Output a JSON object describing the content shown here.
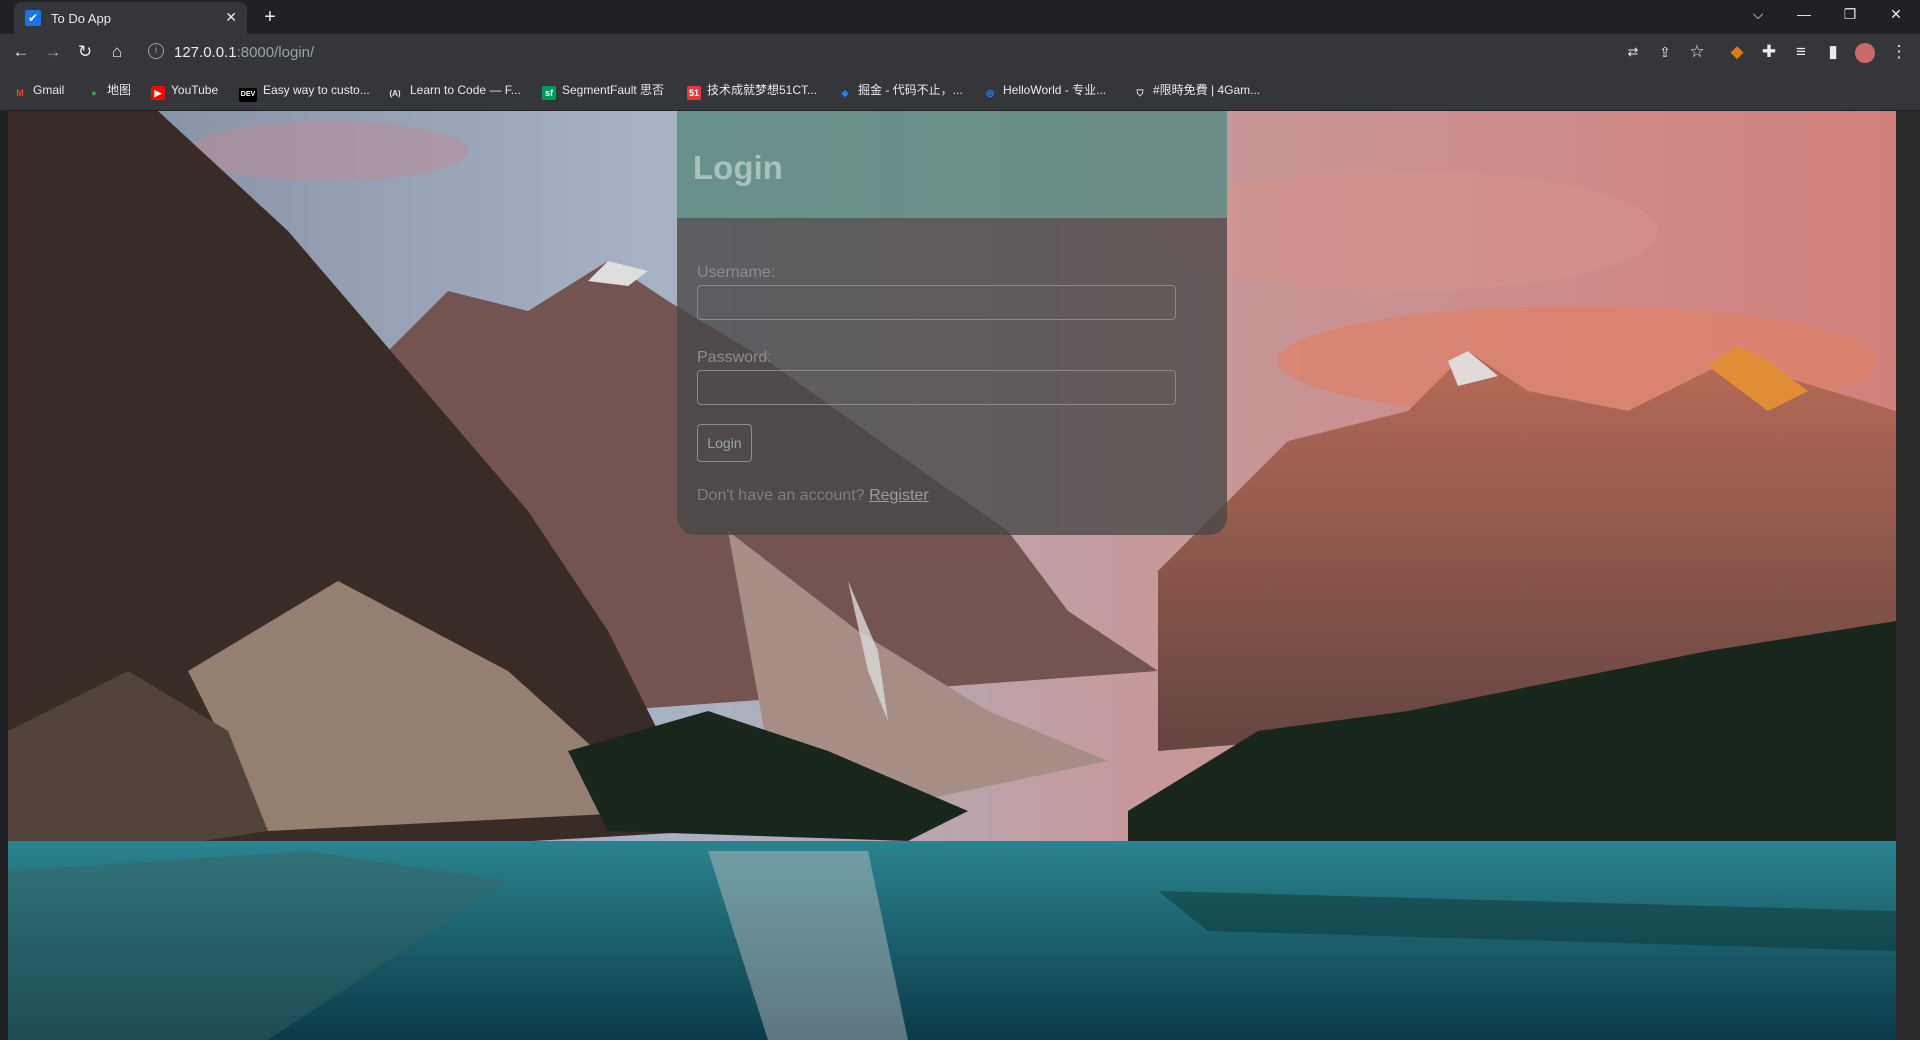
{
  "browser": {
    "tab": {
      "title": "To Do App",
      "favicon": "checkbox-icon",
      "close": "✕"
    },
    "new_tab": "+",
    "window_controls": {
      "collapse": "⌵",
      "minimize": "—",
      "restore": "❐",
      "close": "✕"
    },
    "nav": {
      "back": "←",
      "forward": "→",
      "reload": "↻",
      "home": "⌂"
    },
    "address": {
      "host": "127.0.0.1",
      "path": ":8000/login/"
    },
    "toolbar_icons": [
      "translate-icon",
      "share-icon",
      "bookmark-star-icon",
      "metamask-icon",
      "extensions-icon",
      "reading-list-icon",
      "side-panel-icon",
      "profile-avatar",
      "menu-icon"
    ]
  },
  "bookmarks": [
    {
      "label": "Gmail",
      "icon": "M",
      "color": "#ea4335"
    },
    {
      "label": "地图",
      "icon": "●",
      "color": "#34a853"
    },
    {
      "label": "YouTube",
      "icon": "▶",
      "color": "#ff0000"
    },
    {
      "label": "Easy way to custo...",
      "icon": "DEV",
      "color": "#000000"
    },
    {
      "label": "Learn to Code — F...",
      "icon": "(A)",
      "color": "#0a0a23"
    },
    {
      "label": "SegmentFault 思否",
      "icon": "sf",
      "color": "#009a61"
    },
    {
      "label": "技术成就梦想51CT...",
      "icon": "51",
      "color": "#e4393c"
    },
    {
      "label": "掘金 - 代码不止，...",
      "icon": "◆",
      "color": "#1e80ff"
    },
    {
      "label": "HelloWorld - 专业...",
      "icon": "◎",
      "color": "#3b82f6"
    },
    {
      "label": "#限時免費 | 4Gam...",
      "icon": "⛉",
      "color": "#555555"
    }
  ],
  "login": {
    "title": "Login",
    "username_label": "Username:",
    "username_value": "",
    "password_label": "Password:",
    "password_value": "",
    "submit_label": "Login",
    "no_account_text": "Don't have an account?",
    "register_link": "Register"
  }
}
